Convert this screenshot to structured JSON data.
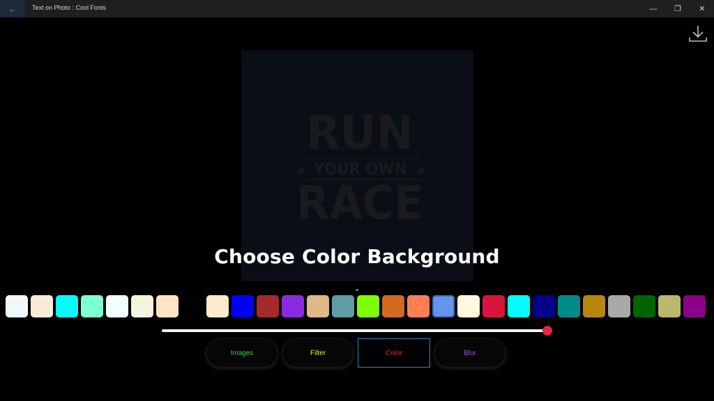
{
  "window": {
    "title": "Text on Photo : Cool Fonts",
    "back_glyph": "←",
    "minimize_glyph": "—",
    "restore_glyph": "❐",
    "close_glyph": "✕"
  },
  "poster": {
    "line1": "RUN",
    "line2": "YOUR OWN",
    "line3": "RACE",
    "star_glyph": "★",
    "text_color": "#181a1d",
    "background": "#0a0e16"
  },
  "heading": "Choose Color Background",
  "icons": {
    "download": "download-icon"
  },
  "palette": {
    "swatches": [
      "#f0f8ff",
      "#faebd7",
      "#00ffff",
      "#7fffd4",
      "#f0ffff",
      "#f5f5dc",
      "#ffe4c4",
      "#000000",
      "#ffebcd",
      "#0000ff",
      "#a52a2a",
      "#8a2be2",
      "#deb887",
      "#5f9ea0",
      "#7fff00",
      "#d2691e",
      "#ff7f50",
      "#6495ed",
      "#fff8dc",
      "#dc143c",
      "#00ffff",
      "#00008b",
      "#008b8b",
      "#b8860b",
      "#a9a9a9",
      "#006400",
      "#bdb76b",
      "#8b008b"
    ],
    "selected_index": 17
  },
  "slider": {
    "value": 1.0
  },
  "tabs": [
    {
      "label": "Images",
      "color": "#3fc93f",
      "active": false
    },
    {
      "label": "Filter",
      "color": "#e6e62e",
      "active": false
    },
    {
      "label": "Color",
      "color": "#e0283e",
      "active": true
    },
    {
      "label": "Blur",
      "color": "#a64ddc",
      "active": false
    }
  ]
}
